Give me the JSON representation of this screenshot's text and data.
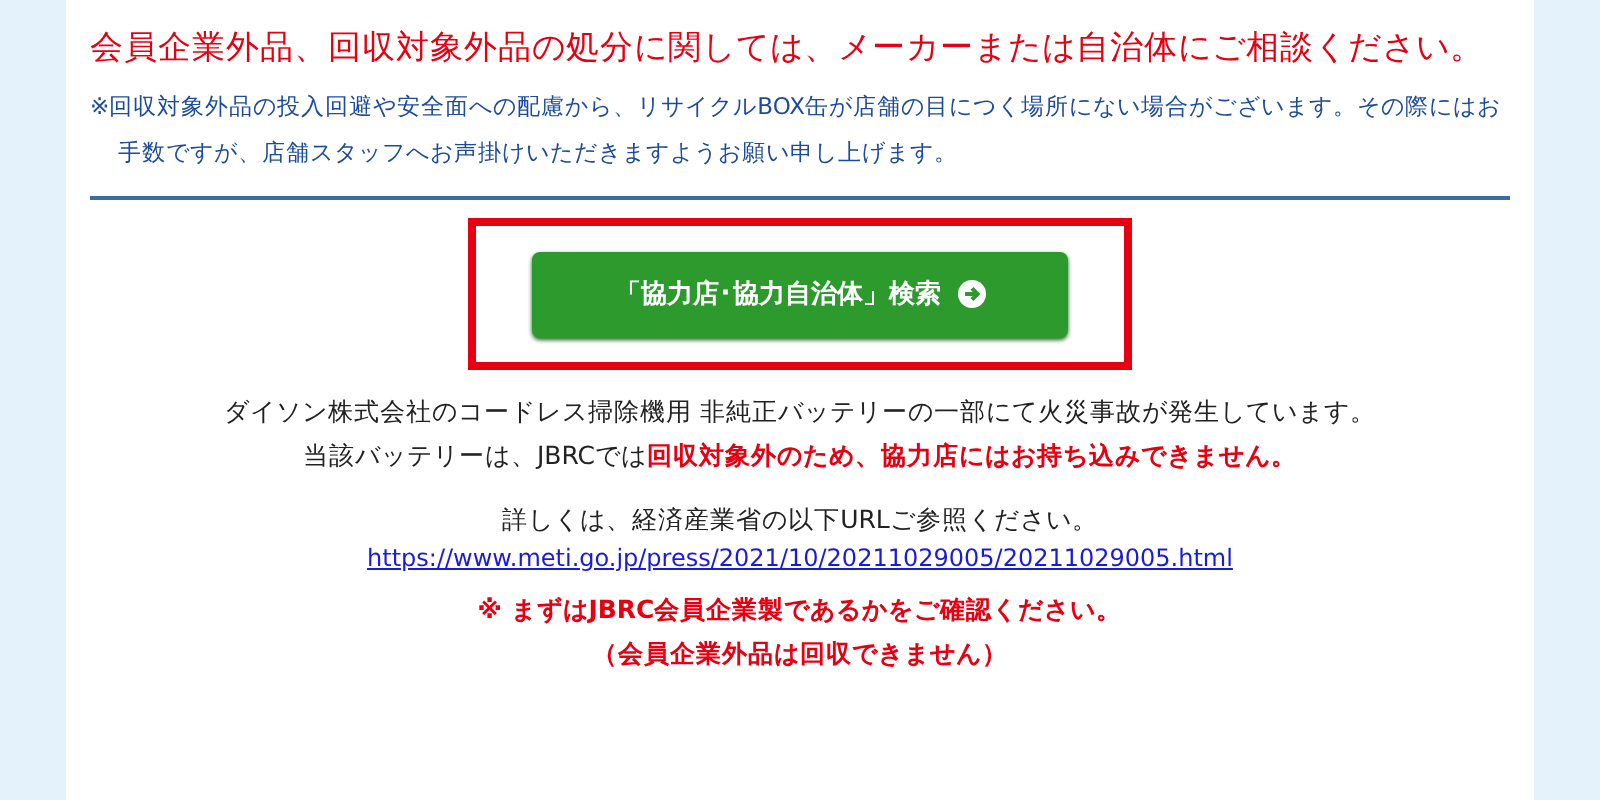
{
  "notice": {
    "headline": "会員企業外品、回収対象外品の処分に関しては、メーカーまたは自治体にご相談ください。",
    "note": "※回収対象外品の投入回避や安全面への配慮から、リサイクルBOX缶が店舗の目につく場所にない場合がございます。その際にはお手数ですが、店舗スタッフへお声掛けいただきますようお願い申し上げます。"
  },
  "search_button": {
    "label": "「協力店･協力自治体」検索",
    "highlighted": true
  },
  "battery_notice": {
    "lines": [
      "ダイソン株式会社のコードレス掃除機用 非純正バッテリーの一部にて火災事故が発生しています。",
      "当該バッテリーは、JBRCでは**回収対象外のため、協力店にはお持ち込みできません。**"
    ],
    "details": "詳しくは、経済産業省の以下URLご参照ください。",
    "link": "https://www.meti.go.jp/press/2021/10/20211029005/20211029005.html",
    "warnings": [
      "※ まずはJBRC会員企業製であるかをご確認ください。",
      "（会員企業外品は回収できません）"
    ]
  }
}
